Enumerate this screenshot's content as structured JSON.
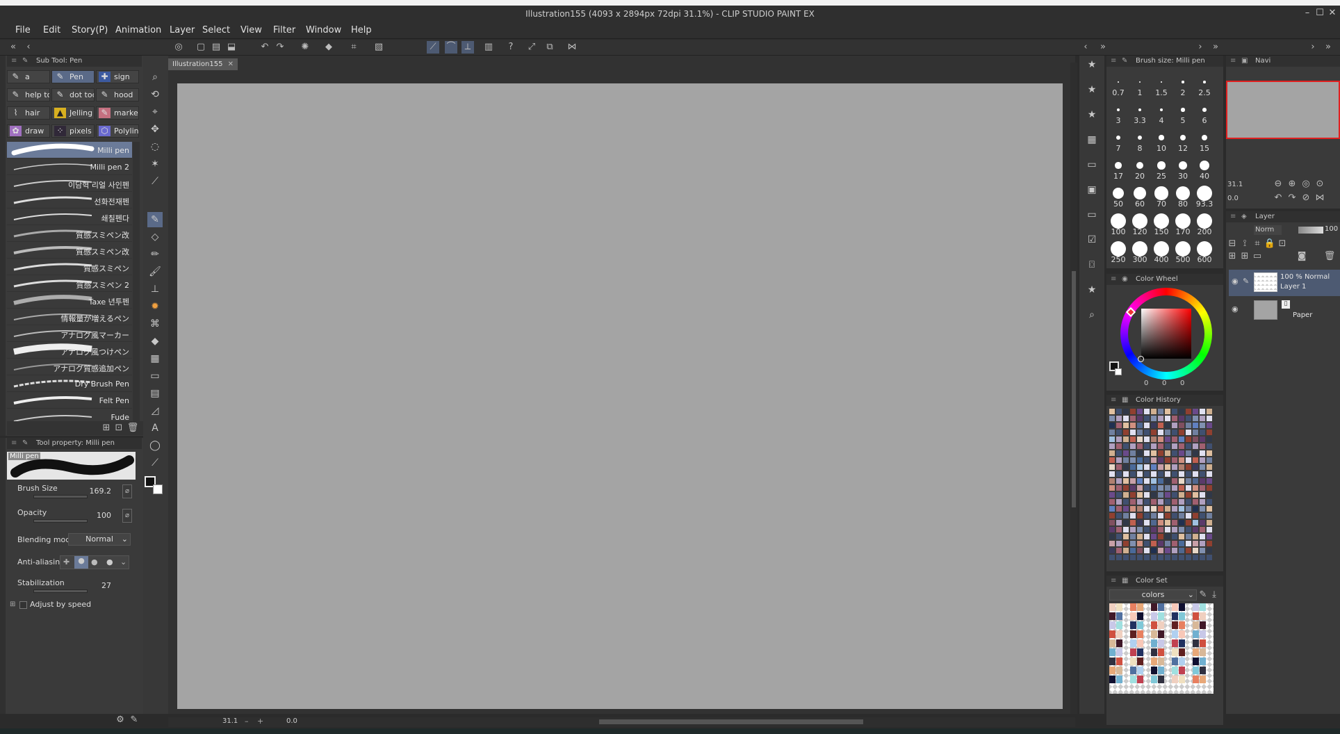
{
  "window": {
    "title": "Illustration155 (4093 x 2894px 72dpi 31.1%) - CLIP STUDIO PAINT EX"
  },
  "menu": [
    "File",
    "Edit",
    "Story(P)",
    "Animation",
    "Layer",
    "Select",
    "View",
    "Filter",
    "Window",
    "Help"
  ],
  "subtool_panel": {
    "title": "Sub Tool: Pen",
    "groups": [
      "a",
      "Pen",
      "sign",
      "help tools",
      "dot tool",
      "hood",
      "hair",
      "Jelling F",
      "marker",
      "draw",
      "pixels",
      "Polyline"
    ],
    "brushes": [
      "Milli pen",
      "Milli pen 2",
      "이담혁 리얼 사인펜",
      "선화전재펜",
      "쇄칠펜다",
      "質感スミペン改",
      "質感スミペン改",
      "質感スミペン",
      "質感スミペン 2",
      "Taxe 년투펜",
      "情報量が増えるペン",
      "アナログ風マーカー",
      "アナログ風つけペン",
      "アナログ質感追加ペン",
      "Dry Brush Pen",
      "Felt Pen",
      "Fude"
    ]
  },
  "tool_property": {
    "title": "Tool property: Milli pen",
    "preview_label": "Milli pen",
    "brush_size": {
      "label": "Brush Size",
      "value": "169.2"
    },
    "opacity": {
      "label": "Opacity",
      "value": "100"
    },
    "blending": {
      "label": "Blending mode",
      "value": "Normal"
    },
    "antialias": {
      "label": "Anti-aliasing"
    },
    "stabilization": {
      "label": "Stabilization",
      "value": "27"
    },
    "adjust": {
      "label": "Adjust by speed"
    }
  },
  "canvas": {
    "tab": "Illustration155",
    "zoom": "31.1",
    "angle": "0.0"
  },
  "brush_size_panel": {
    "title": "Brush size: Milli pen",
    "sizes": [
      "0.7",
      "1",
      "1.5",
      "2",
      "2.5",
      "3",
      "3.3",
      "4",
      "5",
      "6",
      "7",
      "8",
      "10",
      "12",
      "15",
      "17",
      "20",
      "25",
      "30",
      "40",
      "50",
      "60",
      "70",
      "80",
      "93.3",
      "100",
      "120",
      "150",
      "170",
      "200",
      "250",
      "300",
      "400",
      "500",
      "600"
    ]
  },
  "color_wheel": {
    "title": "Color Wheel",
    "values": [
      "0",
      "0",
      "0"
    ]
  },
  "color_history": {
    "title": "Color History"
  },
  "color_set": {
    "title": "Color Set",
    "set_name": "colors"
  },
  "navigator": {
    "title": "Navi",
    "zoom": "31.1",
    "angle": "0.0"
  },
  "layer_panel": {
    "title": "Layer",
    "blend": "Norm",
    "opacity": "100",
    "layers": [
      {
        "info": "100 % Normal",
        "name": "Layer 1"
      },
      {
        "name": "Paper"
      }
    ]
  },
  "colors": {
    "accent": "#6b7b99",
    "canvas": "#a4a4a4",
    "bg": "#2b2b2b",
    "panel": "#3a3a3a"
  }
}
